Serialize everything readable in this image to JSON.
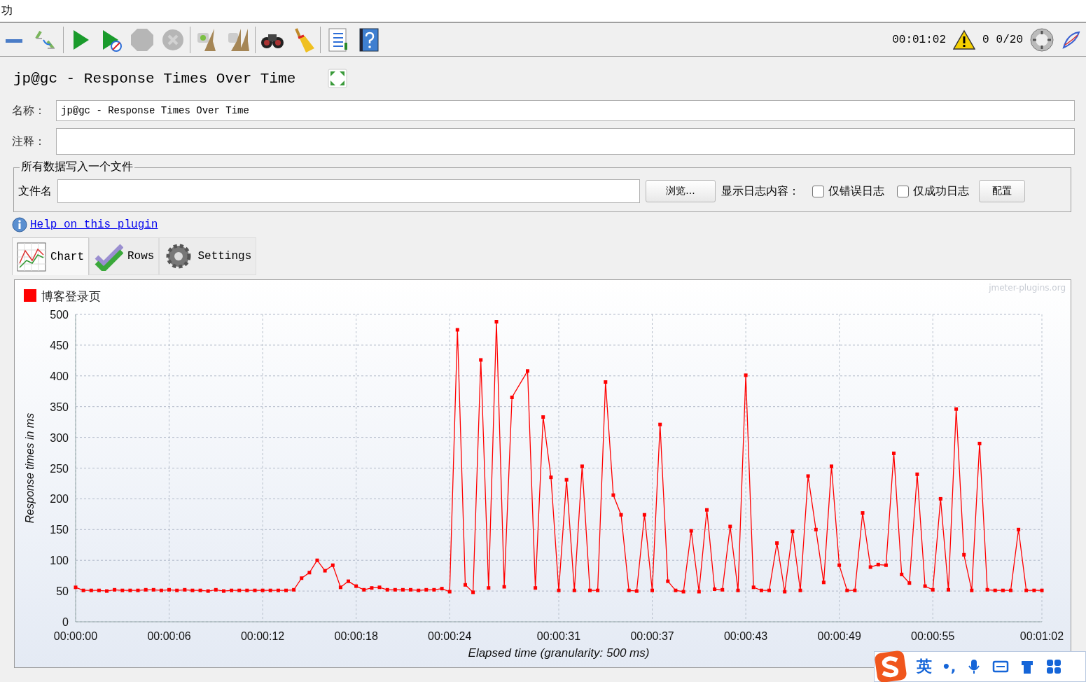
{
  "menu_bar": {
    "cut_text": "功"
  },
  "toolbar": {
    "buttons": [
      {
        "kind": "collapse",
        "disabled": false
      },
      {
        "kind": "toggle",
        "disabled": false
      },
      {
        "kind": "start",
        "disabled": false
      },
      {
        "kind": "start_no_pause",
        "disabled": false
      },
      {
        "kind": "stop",
        "disabled": true
      },
      {
        "kind": "shutdown",
        "disabled": true
      },
      {
        "kind": "clear",
        "disabled": false
      },
      {
        "kind": "clear_all",
        "disabled": false
      },
      {
        "kind": "search",
        "disabled": false
      },
      {
        "kind": "reset",
        "disabled": false
      },
      {
        "kind": "function",
        "disabled": false
      },
      {
        "kind": "help",
        "disabled": false
      }
    ],
    "elapsed": "00:01:02",
    "warnings": "0",
    "threads": "0/20"
  },
  "panel": {
    "title": "jp@gc - Response Times Over Time",
    "name_label": "名称：",
    "name_value": "jp@gc - Response Times Over Time",
    "comment_label": "注释：",
    "file_group": {
      "legend": "所有数据写入一个文件",
      "file_label": "文件名",
      "browse_button": "浏览...",
      "log_label": "显示日志内容：",
      "checkboxes": [
        {
          "label": "仅错误日志",
          "checked": false
        },
        {
          "label": "仅成功日志",
          "checked": false
        }
      ],
      "config_button": "配置"
    },
    "help_link": "Help on this plugin",
    "tabs": [
      {
        "label": "Chart",
        "kind": "chart",
        "selected": true
      },
      {
        "label": "Rows",
        "kind": "rows",
        "selected": false
      },
      {
        "label": "Settings",
        "kind": "settings",
        "selected": false
      }
    ],
    "chart_panel": {
      "brand_text": "jmeter-plugins.org",
      "chart_data": {
        "type": "line",
        "xlabel": "Elapsed time (granularity: 500 ms)",
        "ylabel": "Response times in ms",
        "x": [
          0,
          0.5,
          1,
          1.5,
          2,
          2.5,
          3,
          3.5,
          4,
          4.5,
          5,
          5.5,
          6,
          6.5,
          7,
          7.5,
          8,
          8.5,
          9,
          9.5,
          10,
          10.5,
          11,
          11.5,
          12,
          12.5,
          13,
          13.5,
          14,
          14.5,
          15,
          15.5,
          16,
          16.5,
          17,
          17.5,
          18,
          18.5,
          19,
          19.5,
          20,
          20.5,
          21,
          21.5,
          22,
          22.5,
          23,
          23.5,
          24,
          24.5,
          25,
          25.5,
          26,
          26.5,
          27,
          27.5,
          28,
          28.5,
          29,
          29.5,
          30,
          30.5,
          31,
          31.5,
          32,
          32.5,
          33,
          33.5,
          34,
          34.5,
          35,
          35.5,
          36,
          36.5,
          37,
          37.5,
          38,
          38.5,
          39,
          39.5,
          40,
          40.5,
          41,
          41.5,
          42,
          42.5,
          43,
          43.5,
          44,
          44.5,
          45,
          45.5,
          46,
          46.5,
          47,
          47.5,
          48,
          48.5,
          49,
          49.5,
          50,
          50.5,
          51,
          51.5,
          52,
          52.5,
          53,
          53.5,
          54,
          54.5,
          55,
          55.5,
          56,
          56.5,
          57,
          57.5,
          58,
          58.5,
          59,
          59.5,
          60,
          60.5,
          61,
          61.5,
          62
        ],
        "series": [
          {
            "name": "博客登录页",
            "color": "#ff0000",
            "marker": "square",
            "values": [
              56,
              51,
              51,
              51,
              50,
              52,
              51,
              51,
              51,
              52,
              52,
              51,
              52,
              51,
              52,
              51,
              51,
              50,
              52,
              50,
              51,
              51,
              51,
              51,
              51,
              51,
              51,
              51,
              52,
              71,
              80,
              100,
              83,
              92,
              56,
              66,
              58,
              52,
              55,
              56,
              52,
              52,
              52,
              52,
              51,
              52,
              52,
              54,
              49,
              475,
              60,
              48,
              426,
              55,
              488,
              57,
              365,
              null,
              408,
              55,
              333,
              235,
              51,
              231,
              51,
              253,
              51,
              51,
              390,
              206,
              174,
              51,
              50,
              174,
              51,
              321,
              66,
              51,
              49,
              148,
              49,
              182,
              53,
              52,
              155,
              51,
              401,
              56,
              51,
              51,
              128,
              49,
              147,
              51,
              237,
              150,
              64,
              253,
              92,
              51,
              51,
              177,
              89,
              93,
              92,
              274,
              77,
              63,
              240,
              58,
              52,
              200,
              52,
              346,
              109,
              51,
              290,
              52,
              51,
              51,
              51,
              150,
              51,
              51,
              51
            ]
          }
        ],
        "xlim": [
          0,
          62
        ],
        "ylim": [
          0,
          500
        ],
        "grid": true,
        "xticks": [
          {
            "value": 0,
            "label": "00:00:00"
          },
          {
            "value": 6,
            "label": "00:00:06"
          },
          {
            "value": 12,
            "label": "00:00:12"
          },
          {
            "value": 18,
            "label": "00:00:18"
          },
          {
            "value": 24,
            "label": "00:00:24"
          },
          {
            "value": 31,
            "label": "00:00:31"
          },
          {
            "value": 37,
            "label": "00:00:37"
          },
          {
            "value": 43,
            "label": "00:00:43"
          },
          {
            "value": 49,
            "label": "00:00:49"
          },
          {
            "value": 55,
            "label": "00:00:55"
          },
          {
            "value": 62,
            "label": "00:01:02"
          }
        ],
        "yticks": [
          0,
          50,
          100,
          150,
          200,
          250,
          300,
          350,
          400,
          450,
          500
        ]
      }
    }
  },
  "ime_bar": {
    "mode": "英",
    "punct": "•,"
  }
}
